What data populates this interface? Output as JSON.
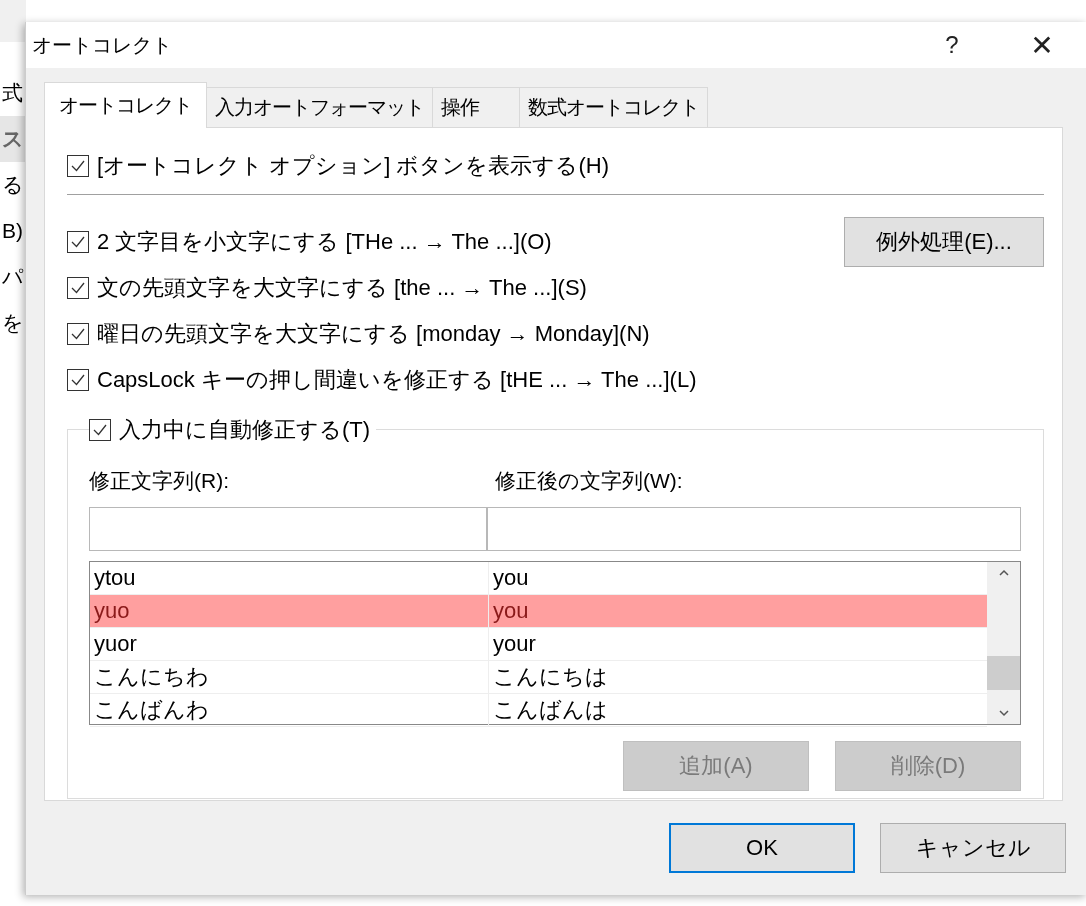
{
  "background_window": {
    "texts": [
      "式",
      "ス",
      "る",
      "B)",
      "パ",
      "を"
    ]
  },
  "window": {
    "title": "オートコレクト",
    "help": "?",
    "close": "✕"
  },
  "tabs": [
    {
      "label": "オートコレクト",
      "selected": true
    },
    {
      "label": "入力オートフォーマット",
      "selected": false
    },
    {
      "label": "操作",
      "selected": false
    },
    {
      "label": "数式オートコレクト",
      "selected": false
    }
  ],
  "options": [
    {
      "label": "[オートコレクト オプション] ボタンを表示する(H)",
      "checked": true
    },
    {
      "label": "2 文字目を小文字にする [THe ... → The ...](O)",
      "checked": true
    },
    {
      "label": "文の先頭文字を大文字にする [the ... → The ...](S)",
      "checked": true
    },
    {
      "label": "曜日の先頭文字を大文字にする [monday → Monday](N)",
      "checked": true
    },
    {
      "label": "CapsLock キーの押し間違いを修正する [tHE ... → The ...](L)",
      "checked": true
    }
  ],
  "exceptions_button": "例外処理(E)...",
  "replace_group": {
    "label": "入力中に自動修正する(T)",
    "checked": true,
    "replace_label": "修正文字列(R):",
    "with_label": "修正後の文字列(W):",
    "rows": [
      {
        "replace": "ytou",
        "with": "you",
        "selected": false
      },
      {
        "replace": "yuo",
        "with": "you",
        "selected": true
      },
      {
        "replace": "yuor",
        "with": "your",
        "selected": false
      },
      {
        "replace": "こんにちわ",
        "with": "こんにちは",
        "selected": false
      },
      {
        "replace": "こんばんわ",
        "with": "こんばんは",
        "selected": false
      }
    ],
    "buttons": [
      {
        "label": "追加(A)",
        "disabled": true
      },
      {
        "label": "削除(D)",
        "disabled": true
      }
    ]
  },
  "footer_buttons": [
    {
      "label": "OK",
      "default": true
    },
    {
      "label": "キャンセル",
      "default": false
    }
  ]
}
